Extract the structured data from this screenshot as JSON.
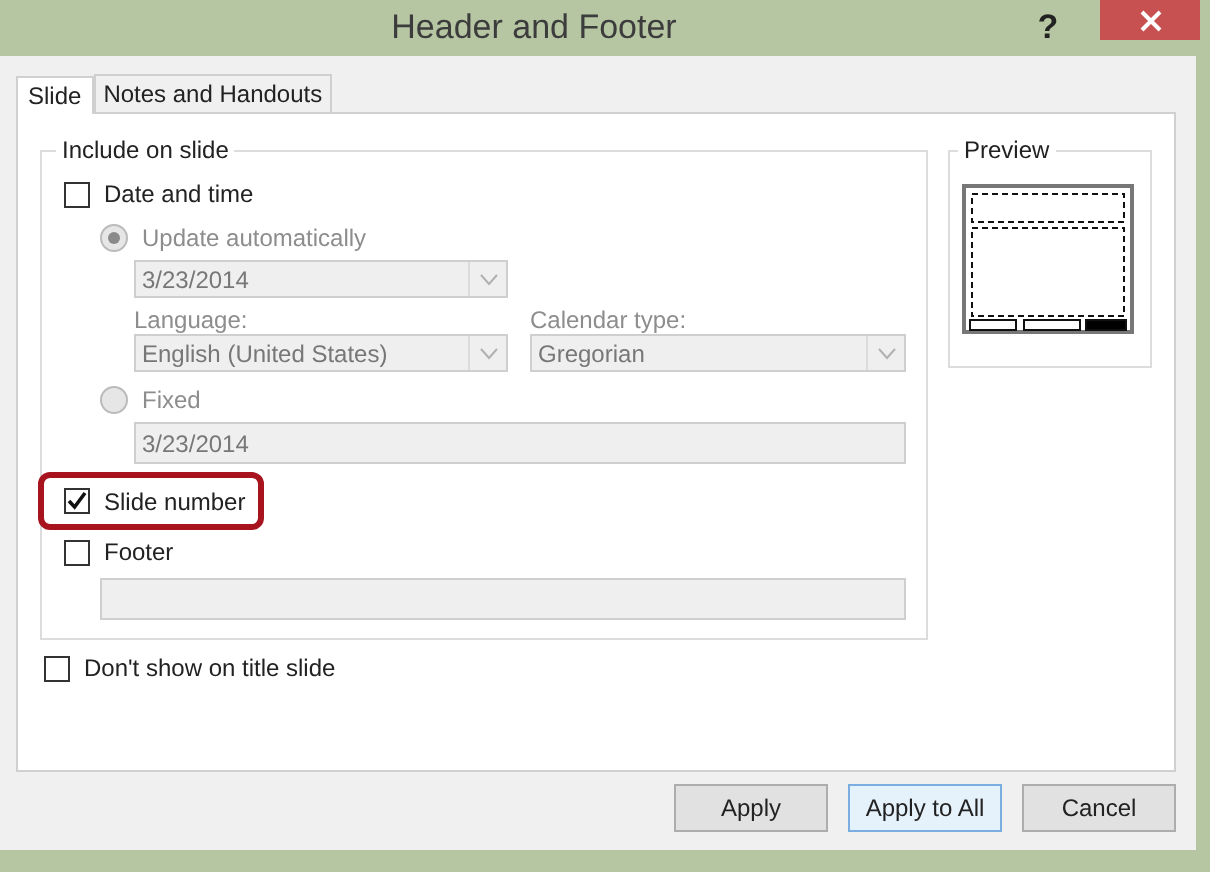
{
  "window": {
    "title": "Header and Footer",
    "help": "?"
  },
  "tabs": [
    {
      "label": "Slide",
      "selected": true
    },
    {
      "label": "Notes and Handouts",
      "selected": false
    }
  ],
  "include_group": {
    "title": "Include on slide",
    "date_time": {
      "label": "Date and time",
      "checked": false
    },
    "update_automatically": {
      "label": "Update automatically",
      "selected": true,
      "value": "3/23/2014"
    },
    "language": {
      "label": "Language:",
      "value": "English (United States)"
    },
    "calendar_type": {
      "label": "Calendar type:",
      "value": "Gregorian"
    },
    "fixed": {
      "label": "Fixed",
      "selected": false,
      "value": "3/23/2014"
    },
    "slide_number": {
      "label": "Slide number",
      "checked": true,
      "highlighted": true
    },
    "footer": {
      "label": "Footer",
      "checked": false
    }
  },
  "dont_show_on_title": {
    "label": "Don't show on title slide",
    "checked": false
  },
  "preview": {
    "title": "Preview"
  },
  "buttons": [
    {
      "label": "Apply",
      "default": false
    },
    {
      "label": "Apply to All",
      "default": true
    },
    {
      "label": "Cancel",
      "default": false
    }
  ]
}
